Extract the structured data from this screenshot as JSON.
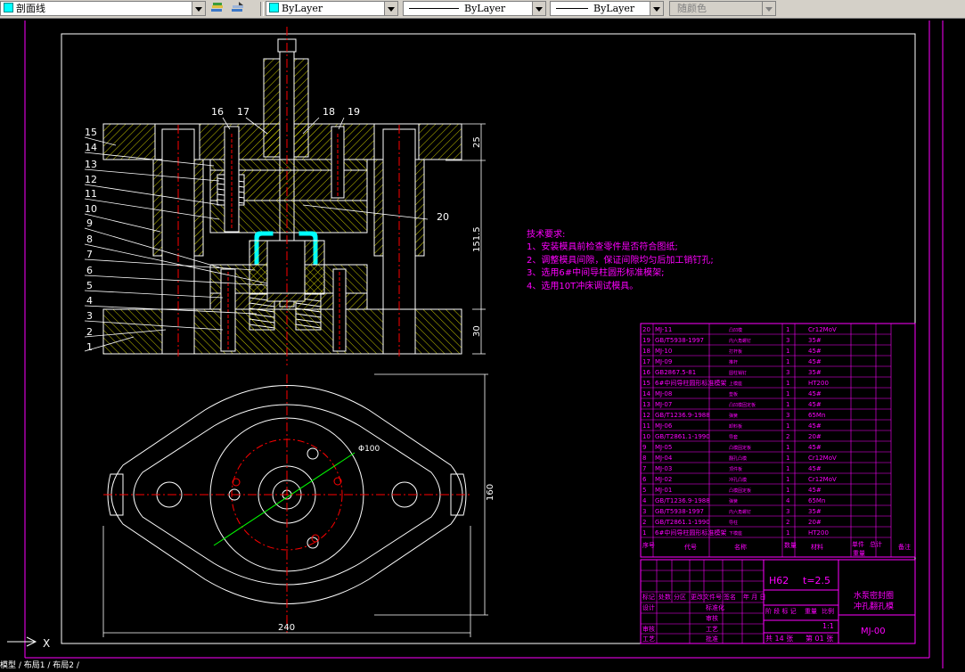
{
  "toolbar": {
    "layer": {
      "value": "剖面线",
      "color": "#00ffff"
    },
    "color": {
      "value": "ByLayer",
      "color": "#00ffff"
    },
    "linetype": {
      "value": "ByLayer"
    },
    "lineweight": {
      "value": "ByLayer"
    },
    "plotstyle": {
      "value": "随颜色"
    },
    "layer_state_icon": "layer-states-icon",
    "layer_prev_icon": "layer-previous-icon"
  },
  "drawing": {
    "part_labels": [
      "1",
      "2",
      "3",
      "4",
      "5",
      "6",
      "7",
      "8",
      "9",
      "10",
      "11",
      "12",
      "13",
      "14",
      "15"
    ],
    "top_labels": [
      "16",
      "17",
      "18",
      "19"
    ],
    "label_20": "20",
    "dim_25": "25",
    "dim_1515": "151.5",
    "dim_30": "30",
    "dim_160": "160",
    "dim_240": "240",
    "dim_phi100": "Φ100",
    "tech_title": "技术要求:",
    "tech_items": [
      "1、安装模具前检查零件是否符合图纸;",
      "2、调整模具间隙，保证间隙均匀后加工销钉孔;",
      "3、选用6#中间导柱圆形标准模架;",
      "4、选用10T冲床调试模具。"
    ],
    "axis_x": "X",
    "layout_tabs": "模型 / 布局1 / 布局2 /"
  },
  "bom": {
    "rows": [
      {
        "no": "20",
        "code": "MJ-11",
        "name": "凸凹模",
        "qty": "1",
        "mat": "Cr12MoV"
      },
      {
        "no": "19",
        "code": "GB/T5938-1997",
        "name": "内六角螺钉",
        "qty": "3",
        "mat": "35#"
      },
      {
        "no": "18",
        "code": "MJ-10",
        "name": "打杆板",
        "qty": "1",
        "mat": "45#"
      },
      {
        "no": "17",
        "code": "MJ-09",
        "name": "推杆",
        "qty": "1",
        "mat": "45#"
      },
      {
        "no": "16",
        "code": "GB2867.5-81",
        "name": "圆柱销钉",
        "qty": "3",
        "mat": "35#"
      },
      {
        "no": "15",
        "code": "6#中间导柱圆形标准模架",
        "name": "上模座",
        "qty": "1",
        "mat": "HT200"
      },
      {
        "no": "14",
        "code": "MJ-08",
        "name": "垫板",
        "qty": "1",
        "mat": "45#"
      },
      {
        "no": "13",
        "code": "MJ-07",
        "name": "凸凹模固定板",
        "qty": "1",
        "mat": "45#"
      },
      {
        "no": "12",
        "code": "GB/T1236.9-1988",
        "name": "弹簧",
        "qty": "3",
        "mat": "65Mn"
      },
      {
        "no": "11",
        "code": "MJ-06",
        "name": "卸料板",
        "qty": "1",
        "mat": "45#"
      },
      {
        "no": "10",
        "code": "GB/T2861.1-1990",
        "name": "导套",
        "qty": "2",
        "mat": "20#"
      },
      {
        "no": "9",
        "code": "MJ-05",
        "name": "凸模固定板",
        "qty": "1",
        "mat": "45#"
      },
      {
        "no": "8",
        "code": "MJ-04",
        "name": "翻孔凸模",
        "qty": "1",
        "mat": "Cr12MoV"
      },
      {
        "no": "7",
        "code": "MJ-03",
        "name": "顶件板",
        "qty": "1",
        "mat": "45#"
      },
      {
        "no": "6",
        "code": "MJ-02",
        "name": "冲孔凸模",
        "qty": "1",
        "mat": "Cr12MoV"
      },
      {
        "no": "5",
        "code": "MJ-01",
        "name": "凸模固定板",
        "qty": "1",
        "mat": "45#"
      },
      {
        "no": "4",
        "code": "GB/T1236.9-1988",
        "name": "弹簧",
        "qty": "4",
        "mat": "65Mn"
      },
      {
        "no": "3",
        "code": "GB/T5938-1997",
        "name": "内六角螺钉",
        "qty": "3",
        "mat": "35#"
      },
      {
        "no": "2",
        "code": "GB/T2861.1-1990",
        "name": "导柱",
        "qty": "2",
        "mat": "20#"
      },
      {
        "no": "1",
        "code": "6#中间导柱圆形标准模架",
        "name": "下模座",
        "qty": "1",
        "mat": "HT200"
      }
    ],
    "header": {
      "no": "序号",
      "code": "代号",
      "name": "名称",
      "qty": "数量",
      "mat": "材料",
      "single": "单件",
      "total": "总计",
      "weight": "重量",
      "remark": "备注"
    }
  },
  "titleblock": {
    "material": "H62",
    "thickness": "t=2.5",
    "name_line1": "水泵密封圈",
    "name_line2": "冲孔翻孔模",
    "drawing_no": "MJ-00",
    "scale": "1:1",
    "sheets": "共 14 张",
    "sheet_no": "第 01 张",
    "labels": {
      "mark": "标记",
      "count": "处数",
      "zone": "分区",
      "doc": "更改文件号",
      "sign": "签名",
      "date": "年 月 日",
      "design": "设计",
      "standard": "标准化",
      "review": "审核",
      "process": "工艺",
      "approve": "批准",
      "check": "审核",
      "stage": "阶 段 标 记",
      "weight": "重量",
      "scale": "比例"
    }
  }
}
